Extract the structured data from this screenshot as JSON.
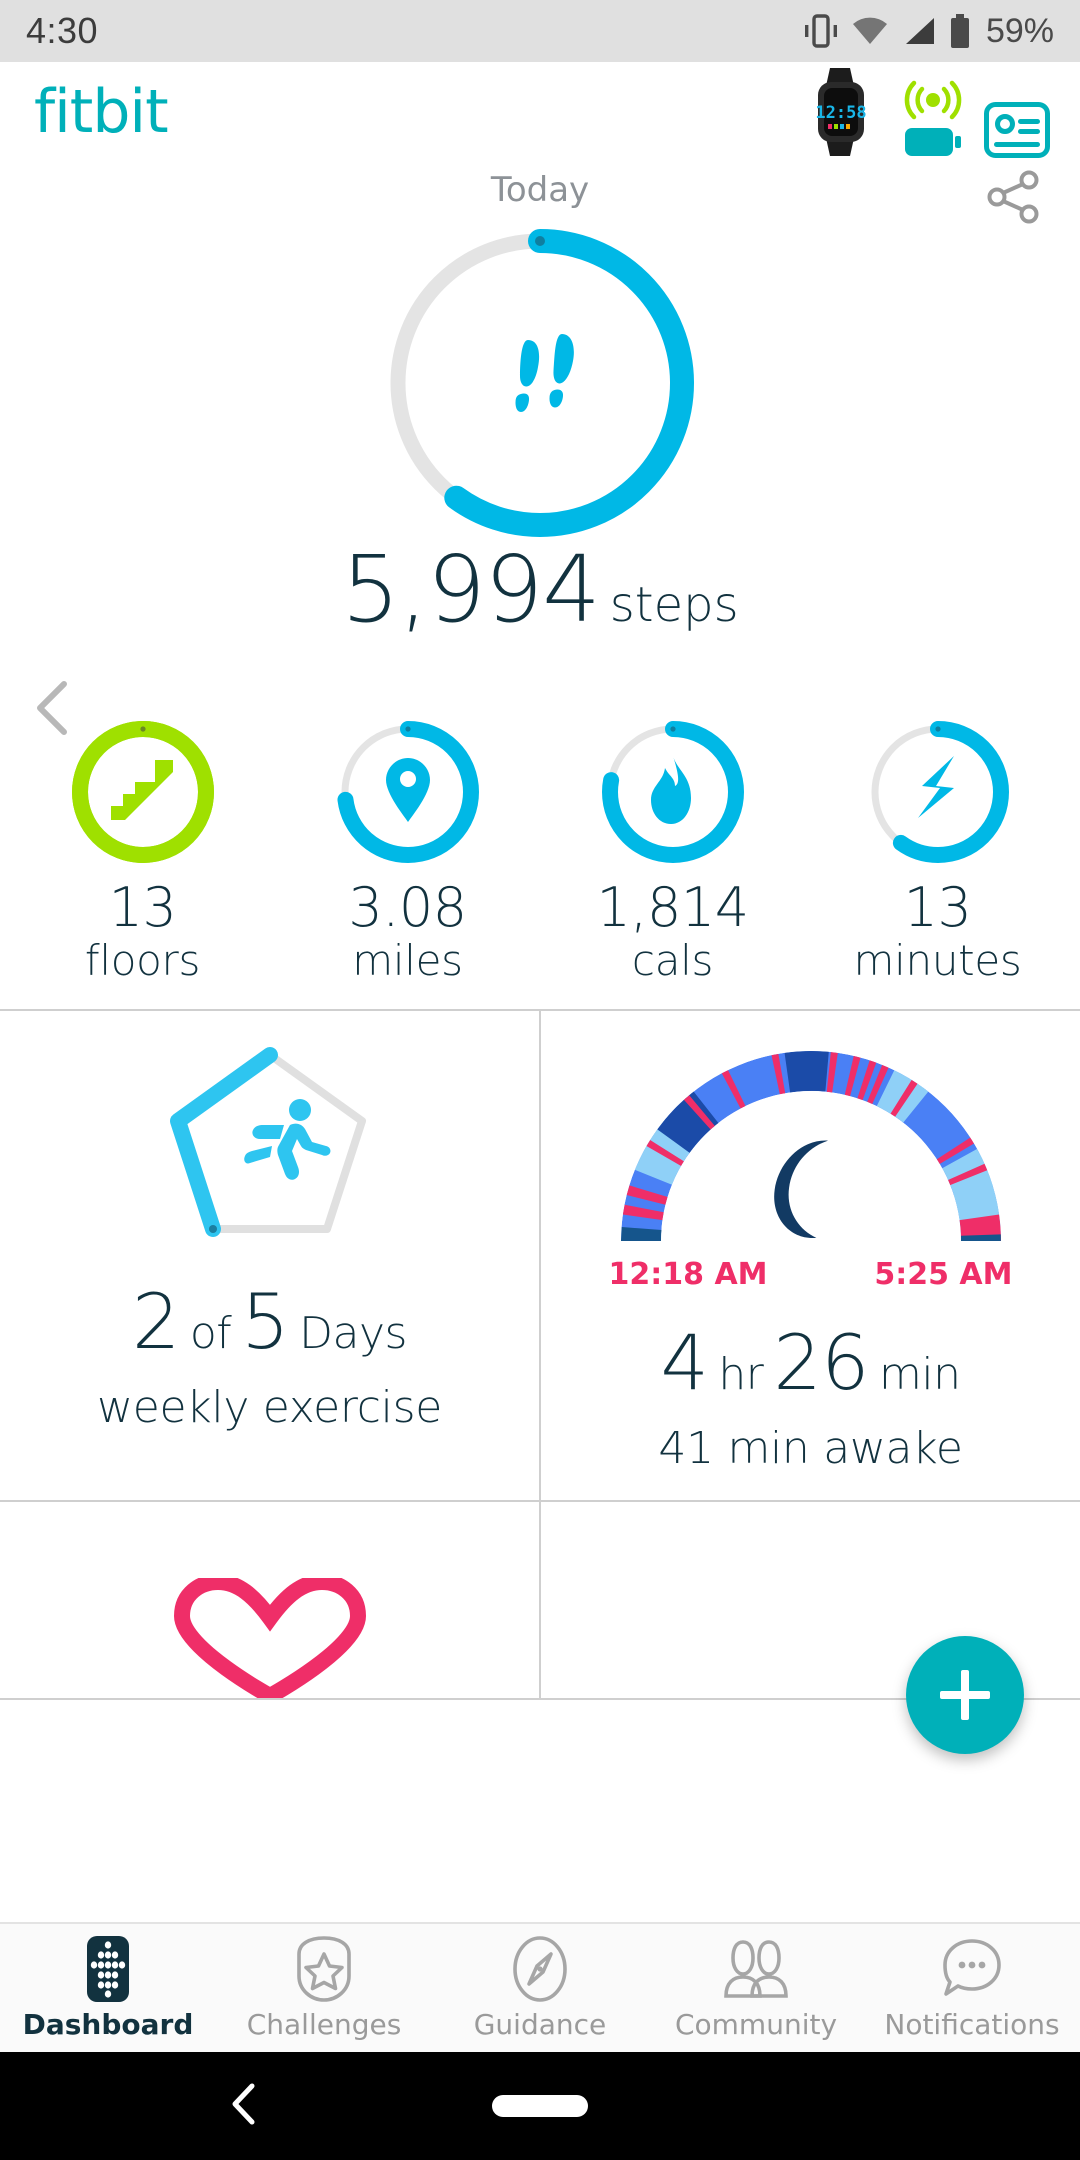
{
  "status_bar": {
    "time": "4:30",
    "battery_percent": "59%",
    "icons": [
      "vibrate-icon",
      "wifi-icon",
      "cellular-signal-icon",
      "battery-icon"
    ]
  },
  "app_header": {
    "brand": "fitbit",
    "device_icon": "fitbit-watch-icon",
    "device_screen_time": "12:58",
    "sync_icon": "sync-signal-icon",
    "battery_icon": "device-battery-icon",
    "account_icon": "account-card-icon"
  },
  "date_nav": {
    "label": "Today",
    "prev_icon": "chevron-left-icon",
    "share_icon": "share-icon"
  },
  "hero": {
    "icon": "footsteps-icon",
    "value": "5,994",
    "unit": "steps",
    "progress_percent": 60,
    "ring_color": "#00b8e6",
    "track_color": "#e4e4e4"
  },
  "stats": [
    {
      "icon": "stairs-icon",
      "value": "13",
      "label": "floors",
      "progress_percent": 100,
      "color": "#9fe000",
      "goal_met": true
    },
    {
      "icon": "location-pin-icon",
      "value": "3.08",
      "label": "miles",
      "progress_percent": 73,
      "color": "#00b8e6",
      "goal_met": false
    },
    {
      "icon": "flame-icon",
      "value": "1,814",
      "label": "cals",
      "progress_percent": 78,
      "color": "#00b8e6",
      "goal_met": false
    },
    {
      "icon": "lightning-bolt-icon",
      "value": "13",
      "label": "minutes",
      "progress_percent": 60,
      "color": "#00b8e6",
      "goal_met": false
    }
  ],
  "cards": {
    "exercise": {
      "icon": "running-person-icon",
      "shield_icon": "pentagon-shield-icon",
      "count": "2",
      "connector": "of",
      "goal": "5",
      "unit": "Days",
      "subtitle": "weekly exercise",
      "days_completed": 2,
      "days_goal": 5,
      "color": "#2ec5f0"
    },
    "sleep": {
      "icon": "crescent-moon-icon",
      "hours": "4",
      "hours_unit": "hr",
      "minutes": "26",
      "minutes_unit": "min",
      "subtitle": "41 min awake",
      "start_time": "12:18 AM",
      "end_time": "5:25 AM",
      "time_color": "#ef2e68",
      "stage_colors": {
        "deep": "#1b4ba8",
        "light": "#4a80f5",
        "rem": "#8fd0f7",
        "awake": "#ef2e68",
        "cap": "#15558c"
      }
    },
    "heart_rate": {
      "icon": "heart-icon",
      "color": "#ef2e68"
    }
  },
  "fab": {
    "icon": "plus-icon",
    "color": "#00b0b9"
  },
  "bottom_nav": {
    "items": [
      {
        "label": "Dashboard",
        "icon": "dashboard-dots-icon",
        "active": true
      },
      {
        "label": "Challenges",
        "icon": "shield-star-icon",
        "active": false
      },
      {
        "label": "Guidance",
        "icon": "compass-icon",
        "active": false
      },
      {
        "label": "Community",
        "icon": "people-icon",
        "active": false
      },
      {
        "label": "Notifications",
        "icon": "speech-bubble-icon",
        "active": false
      }
    ]
  },
  "system_nav": {
    "back_icon": "back-chevron-icon",
    "home_icon": "home-pill-icon"
  }
}
